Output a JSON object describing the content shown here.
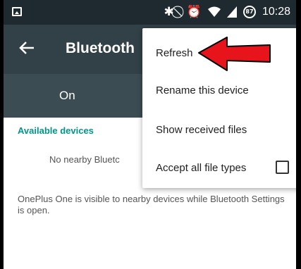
{
  "status_bar": {
    "time": "10:28",
    "battery_level": "87",
    "icons": [
      "notification-image-icon",
      "bluetooth-icon",
      "do-not-disturb-icon",
      "alarm-icon",
      "wifi-icon",
      "signal-icon",
      "battery-icon"
    ]
  },
  "app_bar": {
    "title": "Bluetooth"
  },
  "toggle": {
    "label": "On"
  },
  "available_devices": {
    "header": "Available devices",
    "empty_text": "No nearby Bluetc"
  },
  "visibility_text": "OnePlus One is visible to nearby devices while Bluetooth Settings is open.",
  "menu": {
    "items": [
      {
        "label": "Refresh"
      },
      {
        "label": "Rename this device"
      },
      {
        "label": "Show received files"
      },
      {
        "label": "Accept all file types",
        "checked": false
      }
    ]
  },
  "annotation": {
    "arrow_color": "#e8141c"
  },
  "colors": {
    "status_bar": "#1f2a30",
    "app_bar": "#324047",
    "toggle_row": "#3c4c53",
    "accent": "#009688"
  }
}
